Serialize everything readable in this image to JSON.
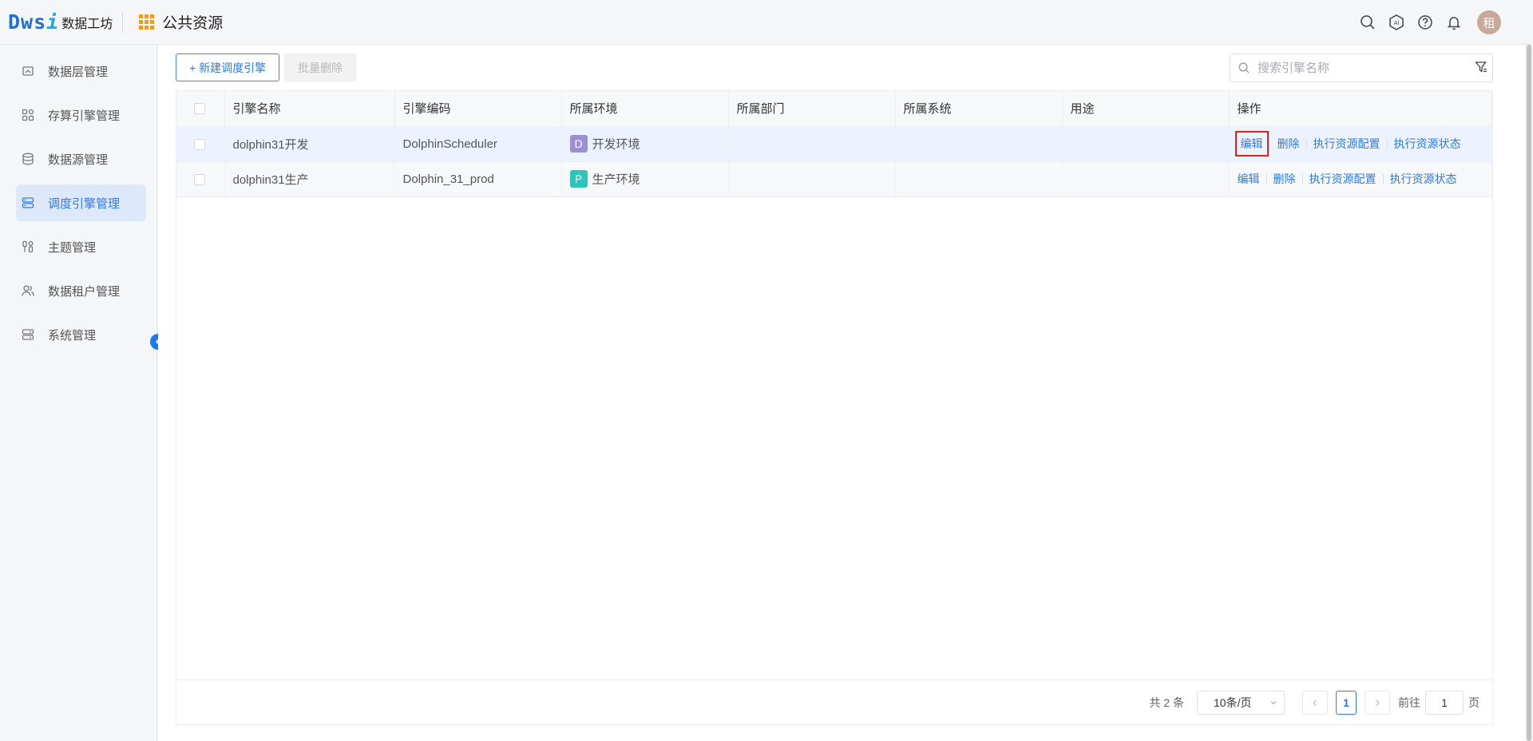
{
  "header": {
    "logo_mark": "Dws",
    "logo_mark_i": "i",
    "logo_text": "数据工坊",
    "app_title": "公共资源",
    "avatar_text": "租"
  },
  "sidebar": {
    "items": [
      {
        "label": "数据层管理",
        "icon": "layers-icon"
      },
      {
        "label": "存算引擎管理",
        "icon": "grid-icon"
      },
      {
        "label": "数据源管理",
        "icon": "database-icon"
      },
      {
        "label": "调度引擎管理",
        "icon": "server-icon",
        "active": true
      },
      {
        "label": "主题管理",
        "icon": "tools-icon"
      },
      {
        "label": "数据租户管理",
        "icon": "users-icon"
      },
      {
        "label": "系统管理",
        "icon": "system-icon"
      }
    ]
  },
  "toolbar": {
    "new_label": "+ 新建调度引擎",
    "batch_delete_label": "批量删除",
    "search_placeholder": "搜索引擎名称"
  },
  "table": {
    "columns": [
      "引擎名称",
      "引擎编码",
      "所属环境",
      "所属部门",
      "所属系统",
      "用途",
      "操作"
    ],
    "rows": [
      {
        "name": "dolphin31开发",
        "code": "DolphinScheduler",
        "env_badge": "D",
        "env_color": "#9b8fd6",
        "env": "开发环境",
        "dept": "",
        "system": "",
        "usage": ""
      },
      {
        "name": "dolphin31生产",
        "code": "Dolphin_31_prod",
        "env_badge": "P",
        "env_color": "#2cc5b8",
        "env": "生产环境",
        "dept": "",
        "system": "",
        "usage": ""
      }
    ],
    "actions": {
      "edit": "编辑",
      "delete": "删除",
      "config": "执行资源配置",
      "status": "执行资源状态"
    }
  },
  "pagination": {
    "total": "共 2 条",
    "page_size": "10条/页",
    "current_page": "1",
    "goto_label": "前往",
    "goto_value": "1",
    "page_unit": "页"
  }
}
